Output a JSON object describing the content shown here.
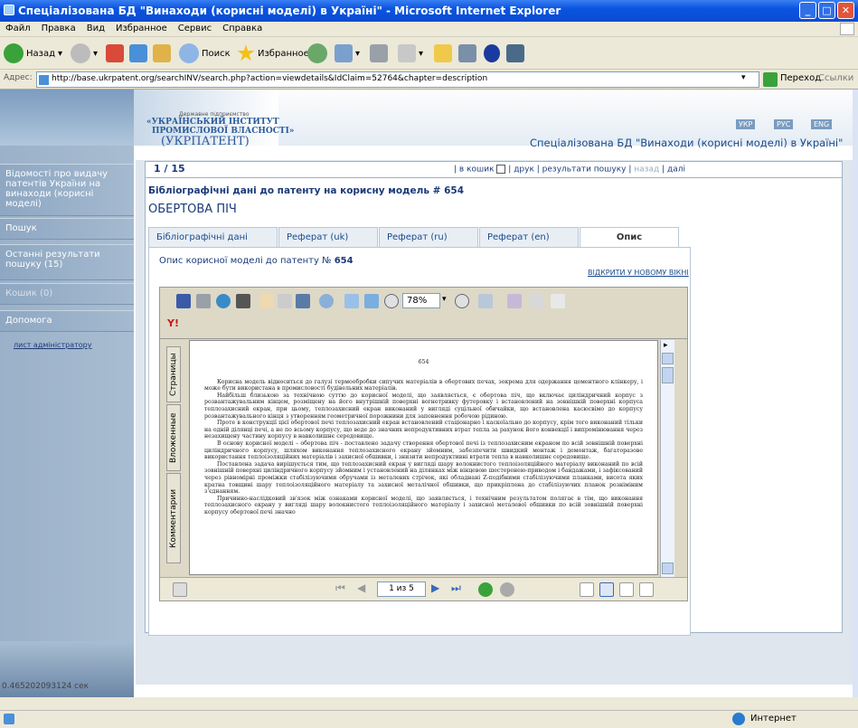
{
  "window": {
    "title": "Спеціалізована БД \"Винаходи (корисні моделі) в Україні\" - Microsoft Internet Explorer"
  },
  "menu": [
    "Файл",
    "Правка",
    "Вид",
    "Избранное",
    "Сервис",
    "Справка"
  ],
  "toolbar": {
    "back": "Назад",
    "search": "Поиск",
    "favorites": "Избранное"
  },
  "address": {
    "label": "Адрес:",
    "url": "http://base.ukrpatent.org/searchINV/search.php?action=viewdetails&IdClaim=52764&chapter=description",
    "go": "Переход",
    "links": "Ссылки"
  },
  "header": {
    "org_small": "Державне підприємство",
    "org_line1": "«УКРАЇНСЬКИЙ ІНСТИТУТ",
    "org_line2": "ПРОМИСЛОВОЇ ВЛАСНОСТІ»",
    "org_abbr": "(УКРПАТЕНТ)",
    "langs": [
      "УКР",
      "РУС",
      "ENG"
    ],
    "db_title": "Спеціалізована БД \"Винаходи (корисні моделі) в Україні\""
  },
  "nav": {
    "items": [
      "Відомості про видачу патентів України на винаходи (корисні моделі)",
      "Пошук",
      "Останні результати пошуку (15)",
      "Кошик (0)",
      "Допомога"
    ],
    "admin_link": "лист адміністратору"
  },
  "record": {
    "counter": "1 / 15",
    "to_cart": "в кошик",
    "print": "друк",
    "results": "результати пошуку",
    "back": "назад",
    "next": "далі",
    "biblio_heading": "Бібліографічні дані до патенту на корисну модель # 654",
    "title": "ОБЕРТОВА ПІЧ"
  },
  "tabs": [
    "Бібліографічні дані",
    "Реферат (uk)",
    "Реферат (ru)",
    "Реферат (en)",
    "Опис"
  ],
  "description": {
    "label": "Опис корисної моделі до патенту №",
    "number": "654",
    "open_new": "ВІДКРИТИ У НОВОМУ ВІКНІ"
  },
  "viewer": {
    "zoom": "78%",
    "side_tabs": [
      "Страницы",
      "Вложенные",
      "Комментарии"
    ],
    "page_nav": "1 из 5"
  },
  "doc": {
    "page_number": "654",
    "paragraphs": [
      "Корисна модель відноситься до галузі термообробки сипучих матеріалів в обертових печах, зокрема для одержання цементного клінкеру, і може бути використана в промисловості будівельних матеріалів.",
      "Найбільш близькою за технічною суттю до корисної моделі, що заявляється, є обертова піч, що включає циліндричний корпус з розвантажувальним кінцем, розміщену на його внутрішній поверхні вогнетривку футеровку і встановлений на зовнішній поверхні корпуса теплозахисний екран, при цьому, теплозахисний екран виконаний у вигляді суцільної обичайки, що встановлена касюсвімо до корпусу розвантажувального кінця з утворенням геометричної порожнини для заповнення робочою рідиною.",
      "Проте в конструкції цієї обертової печі теплозахисний екран встановлений стаціонарно і каскоїально до корпусу, крім того виконаний тільки на одній ділянці печі, а не по всьому корпусу, що веде до значних непродуктивних втрат тепла за рахунок його конвекції і випромінювання через незахищену частину корпусу в навколишнє середовище.",
      "В основу корисної моделі – обертова піч - поставлено задачу створення обертової печі із теплозахисним екраном по всій зовнішній поверхні циліндричного корпусу, шляхом виконання теплозахисного екрану зйомним, забезпечити швидкий монтаж і демонтаж, багаторазове використання теплоізоляційних матеріалів і захисної обшивки, і знизити непродуктивні втрати тепла в навколишнє середовище.",
      "Поставлена задача вирішується тим, що теплозахисний екран у вигляді шару волокнистого теплоізоляційного матеріалу виконаний по всій зовнішній поверхні циліндричного корпусу зйомним і установлений на ділянках між вінцевою шестеренею-приводом і бандажами, і зафіксований через рівномірні проміжки стабілізуючими обручами із металевих стрічок, які обладнані Z-подібними стабілізуючими планками, висота яких кратна товщині шару теплоізоляційного матеріалу та захисної металічної обшивки, що прикріплена до стабілізуючих планок розніміним з'єднанням.",
      "Причинно-наслідковий зв'язок між ознаками корисної моделі, що заявляється, і технічним результатом полягає в тім, що виконання теплозахисного екрану у вигляді шару волокнистого теплоізоляційного матеріалу і захисної металевої обшивки по всій зовнішній поверхні корпусу обертової печі значно"
    ]
  },
  "footer": {
    "timing": "0.465202093124 сек"
  },
  "status": {
    "zone": "Интернет"
  }
}
